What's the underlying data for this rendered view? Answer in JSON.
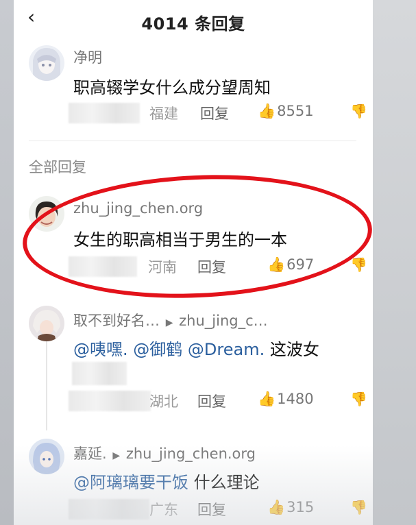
{
  "header": {
    "back_glyph": "‹",
    "title": "4014 条回复"
  },
  "top_comment": {
    "username": "净明",
    "text": "职高辍学女什么成分望周知",
    "location": "福建",
    "reply_label": "回复",
    "likes": "8551"
  },
  "section_label": "全部回复",
  "replies": [
    {
      "username": "zhu_jing_chen.org",
      "text": "女生的职高相当于男生的一本",
      "location": "河南",
      "reply_label": "回复",
      "likes": "697"
    },
    {
      "username": "取不到好名…",
      "reply_to": "zhu_jing_c…",
      "mentions": [
        "@咦嘿.",
        "@御鹤",
        "@Dream."
      ],
      "text_tail": "这波女",
      "location": "湖北",
      "reply_label": "回复",
      "likes": "1480"
    },
    {
      "username": "嘉延.",
      "reply_to": "zhu_jing_chen.org",
      "mentions": [
        "@阿璃璃要干饭"
      ],
      "text_tail": "什么理论",
      "location": "广东",
      "reply_label": "回复",
      "likes": "315"
    }
  ],
  "icons": {
    "like": "thumbs-up-icon",
    "dislike": "thumbs-down-icon",
    "reply_arrow": "caret-right-icon"
  },
  "colors": {
    "highlight_ring": "#e3121a",
    "mention": "#2b5f9e"
  }
}
